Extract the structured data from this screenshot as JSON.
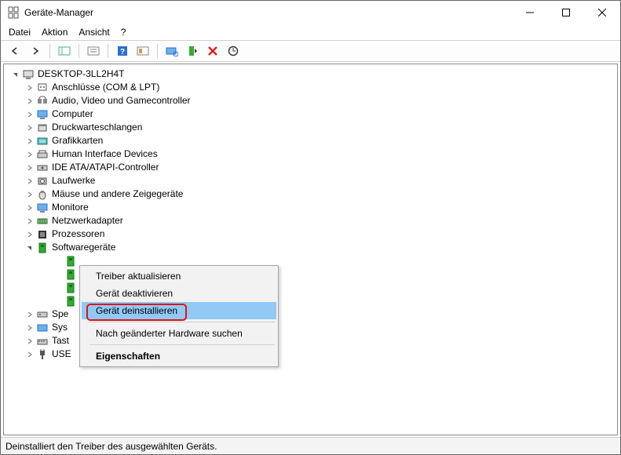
{
  "window": {
    "title": "Geräte-Manager"
  },
  "menu": {
    "file": "Datei",
    "action": "Aktion",
    "view": "Ansicht",
    "help": "?"
  },
  "tree": {
    "root": "DESKTOP-3LL2H4T",
    "children": [
      {
        "label": "Anschlüsse (COM & LPT)"
      },
      {
        "label": "Audio, Video und Gamecontroller"
      },
      {
        "label": "Computer"
      },
      {
        "label": "Druckwarteschlangen"
      },
      {
        "label": "Grafikkarten"
      },
      {
        "label": "Human Interface Devices"
      },
      {
        "label": "IDE ATA/ATAPI-Controller"
      },
      {
        "label": "Laufwerke"
      },
      {
        "label": "Mäuse und andere Zeigegeräte"
      },
      {
        "label": "Monitore"
      },
      {
        "label": "Netzwerkadapter"
      },
      {
        "label": "Prozessoren"
      },
      {
        "label": "Softwaregeräte",
        "expanded": true
      }
    ],
    "softwareDeviceItems": [
      {
        "label": ""
      },
      {
        "label": ""
      },
      {
        "label": ""
      },
      {
        "label": ""
      }
    ],
    "hiddenUnderMenu": [
      {
        "label": "Spe"
      },
      {
        "label": "Sys"
      },
      {
        "label": "Tast"
      },
      {
        "label": "USE"
      }
    ]
  },
  "contextmenu": {
    "items": [
      "Treiber aktualisieren",
      "Gerät deaktivieren",
      "Gerät deinstallieren",
      "Nach geänderter Hardware suchen",
      "Eigenschaften"
    ],
    "highlightedIndex": 2
  },
  "statusbar": {
    "text": "Deinstalliert den Treiber des ausgewählten Geräts."
  }
}
